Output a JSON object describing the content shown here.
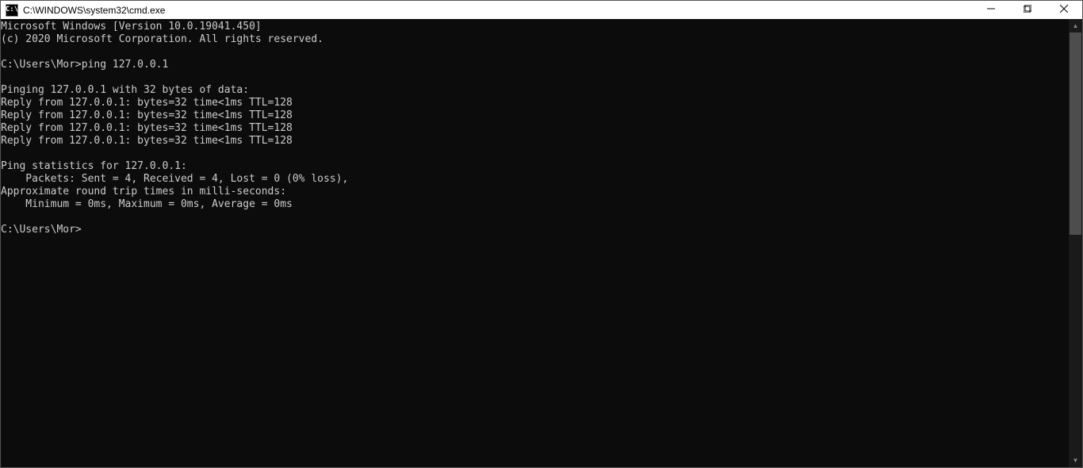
{
  "titlebar": {
    "icon_label": "C:\\",
    "title": "C:\\WINDOWS\\system32\\cmd.exe"
  },
  "terminal": {
    "lines": [
      "Microsoft Windows [Version 10.0.19041.450]",
      "(c) 2020 Microsoft Corporation. All rights reserved.",
      "",
      "C:\\Users\\Mor>ping 127.0.0.1",
      "",
      "Pinging 127.0.0.1 with 32 bytes of data:",
      "Reply from 127.0.0.1: bytes=32 time<1ms TTL=128",
      "Reply from 127.0.0.1: bytes=32 time<1ms TTL=128",
      "Reply from 127.0.0.1: bytes=32 time<1ms TTL=128",
      "Reply from 127.0.0.1: bytes=32 time<1ms TTL=128",
      "",
      "Ping statistics for 127.0.0.1:",
      "    Packets: Sent = 4, Received = 4, Lost = 0 (0% loss),",
      "Approximate round trip times in milli-seconds:",
      "    Minimum = 0ms, Maximum = 0ms, Average = 0ms",
      "",
      "C:\\Users\\Mor>"
    ]
  }
}
